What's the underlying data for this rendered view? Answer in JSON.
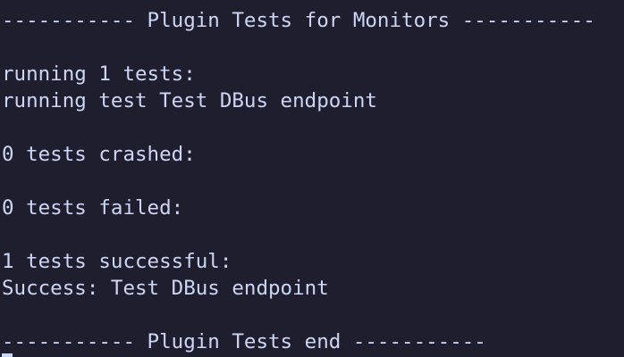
{
  "terminal": {
    "lines": [
      "----------- Plugin Tests for Monitors -----------",
      "running 1 tests:",
      "running test Test DBus endpoint",
      "0 tests crashed:",
      "0 tests failed:",
      "1 tests successful:",
      "Success: Test DBus endpoint",
      "----------- Plugin Tests end -----------"
    ]
  },
  "colors": {
    "background": "#1e1e2e",
    "foreground": "#cdd6f4"
  }
}
